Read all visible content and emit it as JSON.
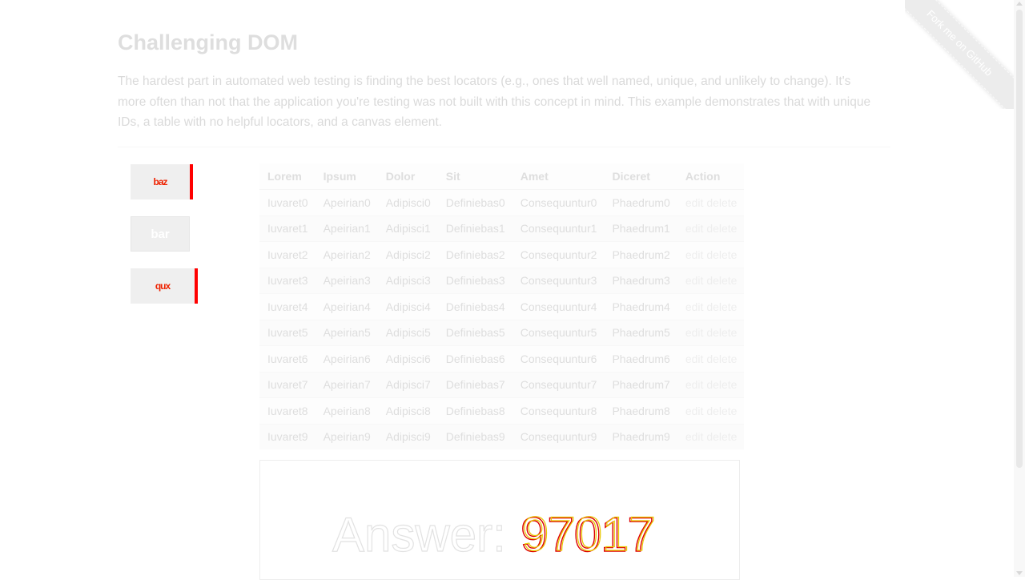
{
  "page": {
    "title": "Challenging DOM",
    "intro": "The hardest part in automated web testing is finding the best locators (e.g., ones that well named, unique, and unlikely to change). It's more often than not that the application you're testing was not built with this concept in mind. This example demonstrates that with unique IDs, a table with no helpful locators, and a canvas element."
  },
  "fork_ribbon": {
    "label": "Fork me on GitHub"
  },
  "buttons": [
    {
      "label": "baz",
      "accent": "#ff0000"
    },
    {
      "label": "bar"
    },
    {
      "label": "qux",
      "accent": "#ff0000"
    }
  ],
  "table": {
    "headers": [
      "Lorem",
      "Ipsum",
      "Dolor",
      "Sit",
      "Amet",
      "Diceret",
      "Action"
    ],
    "rows": [
      [
        "Iuvaret0",
        "Apeirian0",
        "Adipisci0",
        "Definiebas0",
        "Consequuntur0",
        "Phaedrum0"
      ],
      [
        "Iuvaret1",
        "Apeirian1",
        "Adipisci1",
        "Definiebas1",
        "Consequuntur1",
        "Phaedrum1"
      ],
      [
        "Iuvaret2",
        "Apeirian2",
        "Adipisci2",
        "Definiebas2",
        "Consequuntur2",
        "Phaedrum2"
      ],
      [
        "Iuvaret3",
        "Apeirian3",
        "Adipisci3",
        "Definiebas3",
        "Consequuntur3",
        "Phaedrum3"
      ],
      [
        "Iuvaret4",
        "Apeirian4",
        "Adipisci4",
        "Definiebas4",
        "Consequuntur4",
        "Phaedrum4"
      ],
      [
        "Iuvaret5",
        "Apeirian5",
        "Adipisci5",
        "Definiebas5",
        "Consequuntur5",
        "Phaedrum5"
      ],
      [
        "Iuvaret6",
        "Apeirian6",
        "Adipisci6",
        "Definiebas6",
        "Consequuntur6",
        "Phaedrum6"
      ],
      [
        "Iuvaret7",
        "Apeirian7",
        "Adipisci7",
        "Definiebas7",
        "Consequuntur7",
        "Phaedrum7"
      ],
      [
        "Iuvaret8",
        "Apeirian8",
        "Adipisci8",
        "Definiebas8",
        "Consequuntur8",
        "Phaedrum8"
      ],
      [
        "Iuvaret9",
        "Apeirian9",
        "Adipisci9",
        "Definiebas9",
        "Consequuntur9",
        "Phaedrum9"
      ]
    ],
    "edit_label": "edit",
    "delete_label": "delete"
  },
  "canvas": {
    "answer_label": "Answer:",
    "answer_value": "97017"
  },
  "colors": {
    "accent_red": "#ff0000",
    "canvas_outline_red": "#dd0000",
    "canvas_outline_yellow": "#e8c800"
  }
}
